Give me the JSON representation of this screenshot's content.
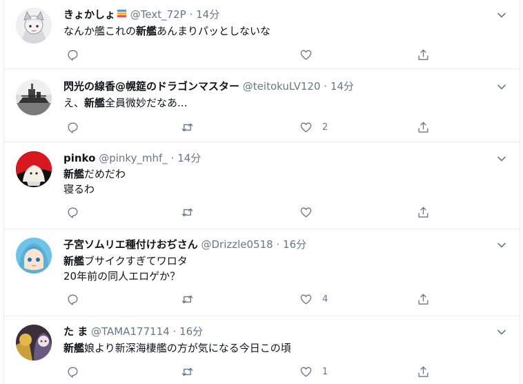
{
  "tweets": [
    {
      "name": "きょかしょ",
      "badge": "books-emoji",
      "handle": "@Text_72P",
      "time": "14分",
      "lines": [
        [
          "",
          "なんか艦これの",
          "新艦",
          "あんまりパッとしないな"
        ]
      ],
      "retweets": "",
      "likes": "",
      "show_retweet": false
    },
    {
      "name": "閃光の線香@幌筵のドラゴンマスター",
      "handle": "@teitokuLV120",
      "time": "14分",
      "lines": [
        [
          "",
          "え、",
          "新艦",
          "全員微妙だなあ..."
        ]
      ],
      "retweets": "",
      "likes": "2",
      "show_retweet": true
    },
    {
      "name": "pinko",
      "handle": "@pinky_mhf_",
      "time": "14分",
      "lines": [
        [
          "",
          "",
          "新艦",
          "だめだわ"
        ],
        [
          "寝るわ",
          "",
          "",
          ""
        ]
      ],
      "retweets": "",
      "likes": "",
      "show_retweet": true
    },
    {
      "name": "子宮ソムリエ種付けおぢさん",
      "handle": "@Drizzle0518",
      "time": "16分",
      "lines": [
        [
          "",
          "",
          "新艦",
          "ブサイクすぎてワロタ"
        ],
        [
          "20年前の同人エロゲか？",
          "",
          "",
          ""
        ]
      ],
      "retweets": "",
      "likes": "4",
      "show_retweet": true
    },
    {
      "name": "た ま",
      "handle": "@TAMA177114",
      "time": "16分",
      "lines": [
        [
          "",
          "",
          "新艦",
          "娘より新深海棲艦の方が気になる今日この頃"
        ]
      ],
      "retweets": "",
      "likes": "1",
      "show_retweet": true
    }
  ],
  "separator": "·",
  "colors": {
    "text": "#0f1419",
    "secondary": "#657786",
    "border": "#e6ecf0"
  }
}
